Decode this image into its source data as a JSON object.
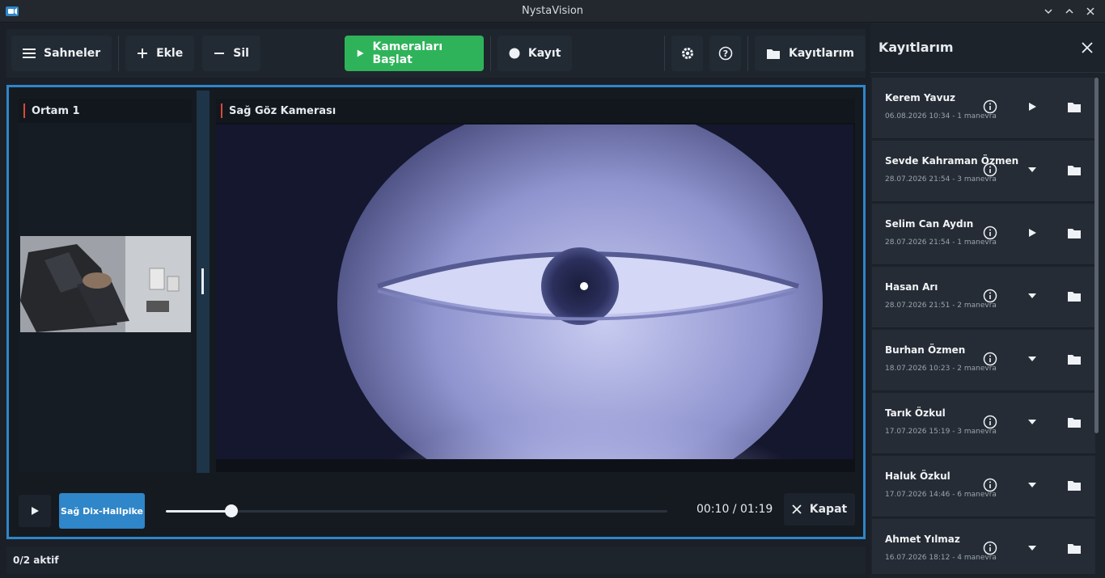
{
  "window": {
    "title": "NystaVision"
  },
  "toolbar": {
    "scenes_label": "Sahneler",
    "add_label": "Ekle",
    "delete_label": "Sil",
    "start_label": "Kameraları Başlat",
    "record_label": "Kayıt",
    "recordings_label": "Kayıtlarım",
    "accent_color": "#2fb35a"
  },
  "stage": {
    "left_pane_title": "Ortam 1",
    "right_pane_title": "Sağ Göz Kamerası"
  },
  "player": {
    "tag_label": "Sağ Dix-Hallpike",
    "progress": 0.13,
    "time": "00:10 / 01:19",
    "close_label": "Kapat"
  },
  "status": {
    "text": "0/2 aktif"
  },
  "recordings": {
    "title": "Kayıtlarım",
    "items": [
      {
        "name": "Kerem Yavuz",
        "meta": "06.08.2026 10:34 - 1 manevra",
        "action": "play"
      },
      {
        "name": "Sevde Kahraman Özmen",
        "meta": "28.07.2026 21:54 - 3 manevra",
        "action": "expand"
      },
      {
        "name": "Selim Can Aydın",
        "meta": "28.07.2026 21:54 - 1 manevra",
        "action": "play"
      },
      {
        "name": "Hasan Arı",
        "meta": "28.07.2026 21:51 - 2 manevra",
        "action": "expand"
      },
      {
        "name": "Burhan Özmen",
        "meta": "18.07.2026 10:23 - 2 manevra",
        "action": "expand"
      },
      {
        "name": "Tarık Özkul",
        "meta": "17.07.2026 15:19 - 3 manevra",
        "action": "expand"
      },
      {
        "name": "Haluk Özkul",
        "meta": "17.07.2026 14:46 - 6 manevra",
        "action": "expand"
      },
      {
        "name": "Ahmet Yılmaz",
        "meta": "16.07.2026 18:12 - 4 manevra",
        "action": "expand"
      }
    ]
  }
}
